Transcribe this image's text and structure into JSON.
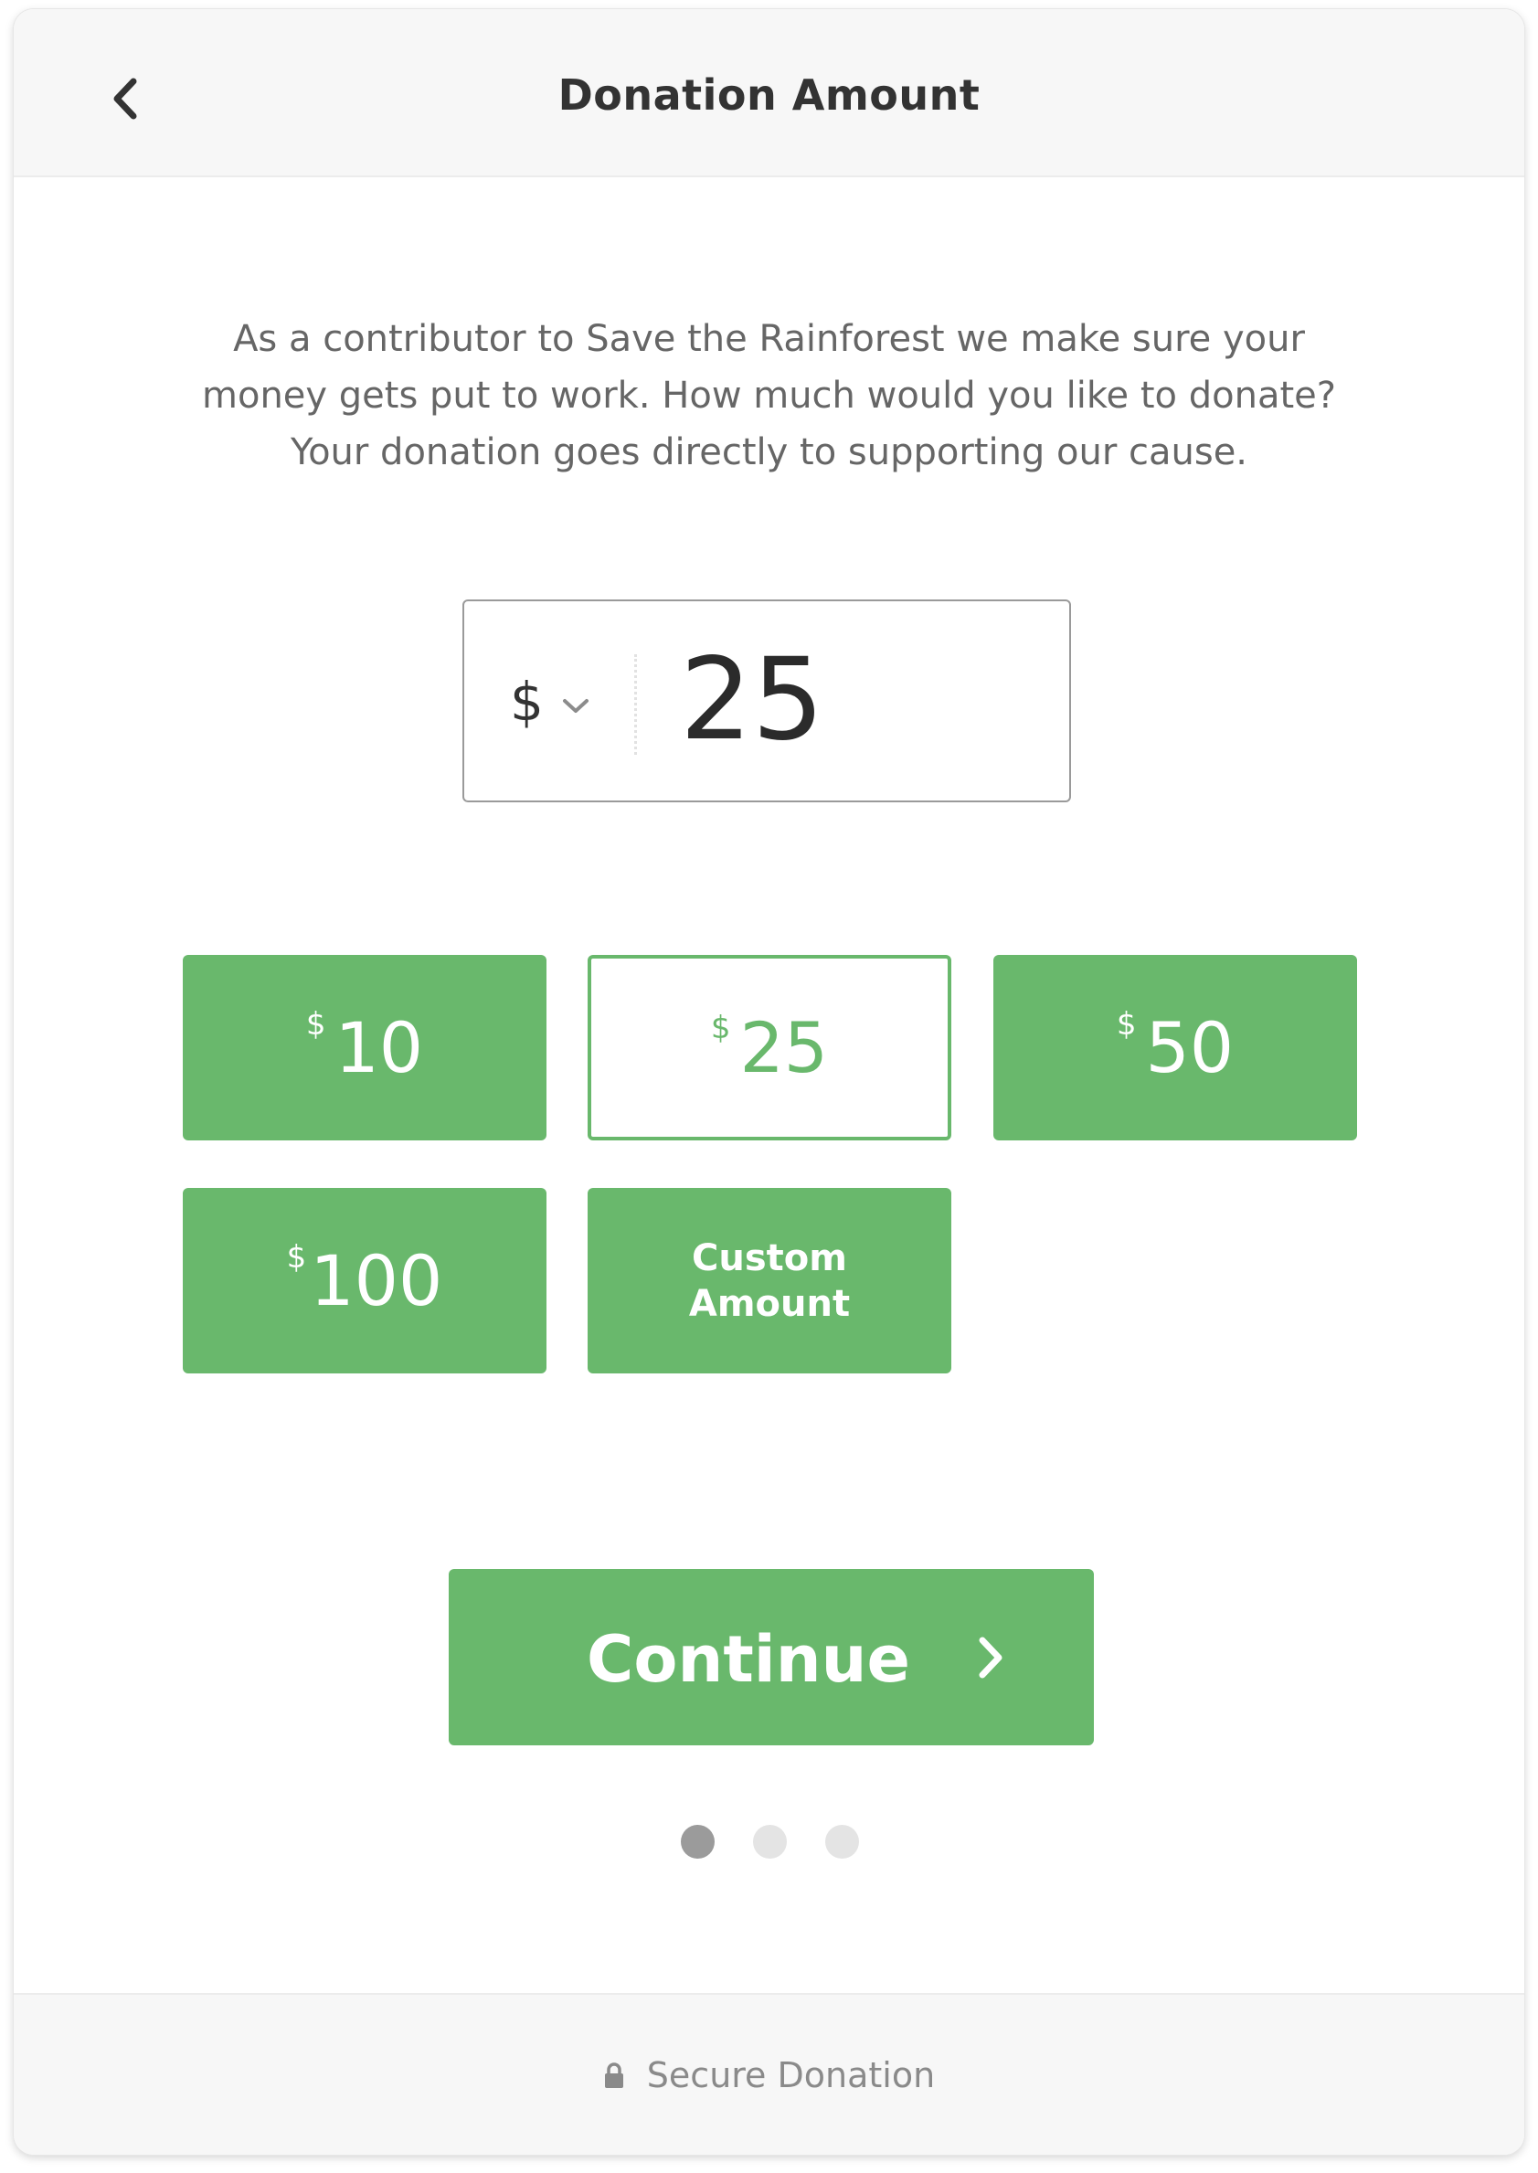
{
  "header": {
    "title": "Donation Amount",
    "back_icon": "chevron-left-icon"
  },
  "intro": {
    "line1": "As a contributor to Save the Rainforest we make sure your",
    "line2": "money gets put to work. How much would you like to donate?",
    "line3": "Your donation goes directly to supporting our cause."
  },
  "amount_input": {
    "currency_symbol": "$",
    "currency_icon": "chevron-down-icon",
    "value": "25"
  },
  "presets": [
    {
      "currency": "$",
      "value": "10",
      "selected": false
    },
    {
      "currency": "$",
      "value": "25",
      "selected": true
    },
    {
      "currency": "$",
      "value": "50",
      "selected": false
    },
    {
      "currency": "$",
      "value": "100",
      "selected": false
    }
  ],
  "custom_amount": {
    "line1": "Custom",
    "line2": "Amount"
  },
  "continue_button": {
    "label": "Continue",
    "icon": "chevron-right-icon"
  },
  "pagination": {
    "total": 3,
    "current": 1
  },
  "footer": {
    "text": "Secure Donation",
    "icon": "lock-icon"
  },
  "colors": {
    "accent": "#69b86c",
    "header_bg": "#f7f7f7",
    "text_primary": "#333333",
    "text_secondary": "#666666"
  }
}
